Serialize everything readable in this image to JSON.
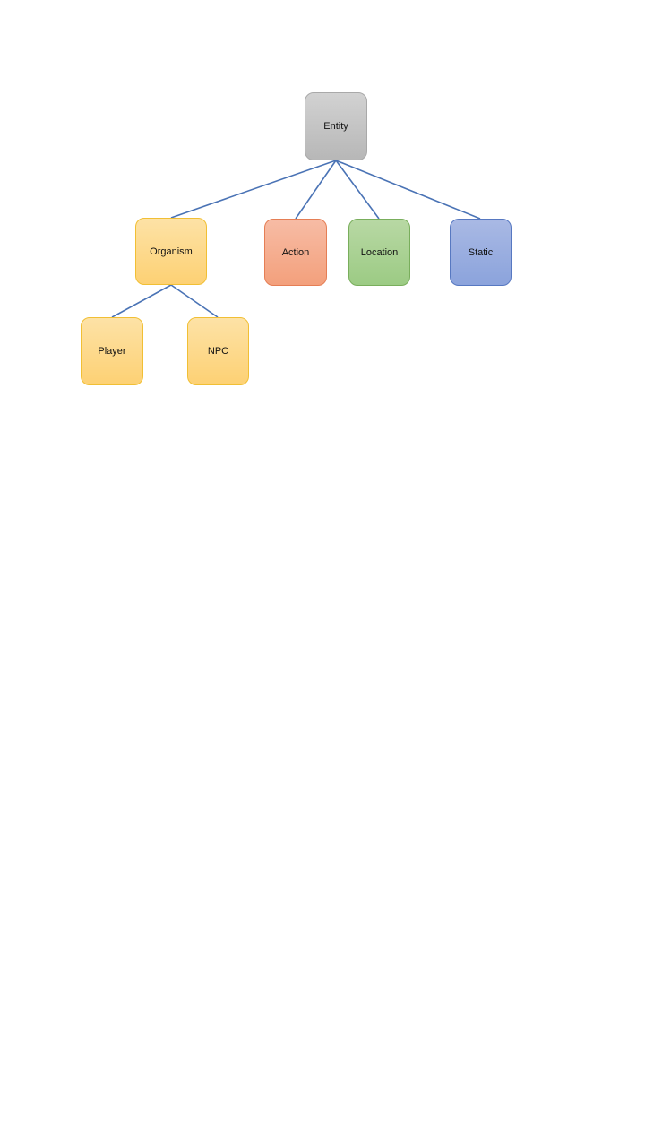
{
  "diagram": {
    "nodes": {
      "entity": {
        "label": "Entity",
        "fill": "#c4c4c4",
        "border": "#a9a9a9"
      },
      "organism": {
        "label": "Organism",
        "fill": "#fed98c",
        "border": "#f1bf34"
      },
      "action": {
        "label": "Action",
        "fill": "#f5ad8f",
        "border": "#e57e55"
      },
      "location": {
        "label": "Location",
        "fill": "#aad192",
        "border": "#79ae5c"
      },
      "static": {
        "label": "Static",
        "fill": "#9aaee0",
        "border": "#5778c1"
      },
      "player": {
        "label": "Player",
        "fill": "#fed98c",
        "border": "#f1bf34"
      },
      "npc": {
        "label": "NPC",
        "fill": "#fed98c",
        "border": "#f1bf34"
      }
    },
    "edges": [
      {
        "from": "Entity",
        "to": "Organism"
      },
      {
        "from": "Entity",
        "to": "Action"
      },
      {
        "from": "Entity",
        "to": "Location"
      },
      {
        "from": "Entity",
        "to": "Static"
      },
      {
        "from": "Organism",
        "to": "Player"
      },
      {
        "from": "Organism",
        "to": "NPC"
      }
    ],
    "connector_color": "#4a73b5"
  }
}
